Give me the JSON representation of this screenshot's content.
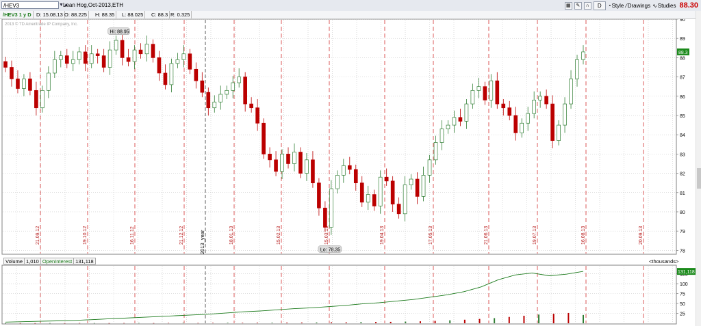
{
  "toolbar": {
    "symbol": "/HEV3",
    "description": "Lean Hog,Oct-2013,ETH",
    "period_button": "D",
    "style_label": "Style",
    "drawings_label": "Drawings",
    "studies_label": "Studies",
    "last_price": "88.30",
    "accent_color": "#cc0000"
  },
  "ohlc_bar": {
    "symbol_period": "/HEV3 1 y D",
    "date": "D: 15.08.13",
    "open": "O: 88.225",
    "high": "H: 88.35",
    "low": "L: 88.025",
    "close": "C: 88.3",
    "range": "R: 0.325"
  },
  "copyright": "2013 © TD Ameritrade IP Company, Inc.",
  "volume_header": {
    "volume_label": "Volume",
    "volume_value": "1,010",
    "oi_label": "OpenInterest",
    "oi_value": "131,118",
    "units": "<thousands>"
  },
  "chart_data": [
    {
      "type": "candlestick",
      "title": "",
      "ylim": [
        77.8,
        90
      ],
      "y_ticks": [
        78,
        79,
        80,
        81,
        82,
        83,
        84,
        85,
        86,
        87,
        88,
        89,
        90
      ],
      "last_price_label": "88.3",
      "high_label": "Hi: 88.95",
      "low_label": "Lo: 78.35",
      "year_marker": "2013_year",
      "month_markers": [
        "21.09.12",
        "19.10.12",
        "16.11.12",
        "21.12.12",
        "18.01.13",
        "15.02.13",
        "15.03.13",
        "19.04.13",
        "17.05.13",
        "21.06.13",
        "19.07.13",
        "16.08.13",
        "20.09.13"
      ],
      "colors": {
        "up": "#2e7d32",
        "down": "#bb0000",
        "grid": "#bdbdbd",
        "marker": "#d32f2f"
      },
      "closes": [
        87.5,
        86.9,
        86.4,
        86.9,
        86.3,
        85.4,
        86.3,
        87.2,
        87.9,
        88.1,
        87.7,
        87.9,
        88.3,
        87.7,
        88.2,
        88.1,
        87.5,
        88.4,
        88.9,
        88.0,
        87.8,
        88.4,
        88.2,
        88.7,
        88.0,
        87.2,
        86.6,
        87.7,
        87.9,
        88.2,
        87.4,
        86.8,
        86.2,
        85.4,
        85.7,
        86.1,
        86.3,
        86.7,
        87.0,
        85.6,
        85.4,
        84.6,
        83.0,
        82.7,
        82.1,
        83.0,
        82.5,
        83.1,
        82.0,
        82.7,
        81.5,
        80.2,
        79.2,
        81.2,
        81.9,
        82.4,
        82.2,
        81.5,
        80.5,
        80.9,
        80.3,
        81.8,
        81.6,
        80.4,
        79.9,
        81.4,
        81.7,
        80.8,
        81.9,
        82.7,
        83.6,
        84.3,
        84.5,
        84.9,
        84.7,
        85.6,
        86.3,
        86.5,
        85.8,
        86.8,
        85.6,
        85.4,
        85.0,
        84.1,
        84.6,
        85.1,
        85.8,
        86.0,
        85.6,
        83.7,
        84.5,
        85.6,
        86.9,
        87.9,
        88.3
      ]
    },
    {
      "type": "bar_line",
      "title": "Volume / OpenInterest",
      "ylim": [
        0,
        145
      ],
      "y_ticks": [
        25,
        50,
        75,
        100,
        125
      ],
      "oi_label": "131,118",
      "open_interest": [
        3,
        4,
        5,
        6,
        7,
        9,
        11,
        13,
        15,
        17,
        19,
        21,
        23,
        26,
        29,
        31,
        34,
        37,
        39,
        42,
        45,
        49,
        52,
        56,
        60,
        66,
        72,
        80,
        92,
        110,
        122,
        127,
        120,
        124,
        131
      ],
      "volume": [
        0.3,
        0.4,
        0.3,
        0.5,
        0.4,
        0.6,
        0.5,
        0.4,
        0.6,
        0.7,
        0.5,
        0.8,
        0.9,
        0.7,
        1,
        1.2,
        1.1,
        1.4,
        1.3,
        1.6,
        1.8,
        2,
        2.4,
        2.2,
        2.8,
        3.2,
        3.6,
        4.2,
        5,
        6,
        7.5,
        9,
        11,
        13,
        16,
        19,
        22,
        24,
        26,
        21
      ]
    }
  ]
}
